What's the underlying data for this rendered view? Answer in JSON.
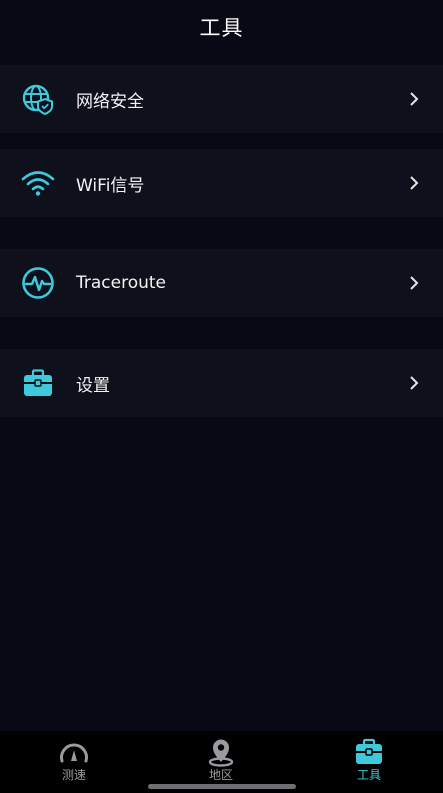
{
  "header": {
    "title": "工具"
  },
  "rows": [
    {
      "label": "网络安全",
      "icon": "globe-shield-icon"
    },
    {
      "label": "WiFi信号",
      "icon": "wifi-icon"
    },
    {
      "label": "Traceroute",
      "icon": "pulse-icon"
    },
    {
      "label": "设置",
      "icon": "toolbox-icon"
    }
  ],
  "tabbar": {
    "tabs": [
      {
        "label": "测速",
        "icon": "speedometer-icon",
        "active": false
      },
      {
        "label": "地区",
        "icon": "location-pin-icon",
        "active": false
      },
      {
        "label": "工具",
        "icon": "toolbox-icon",
        "active": true
      }
    ]
  },
  "colors": {
    "background": "#080914",
    "row_background": "#0e111b",
    "accent": "#3fc9dc",
    "inactive_tab": "#9a9aa0"
  }
}
